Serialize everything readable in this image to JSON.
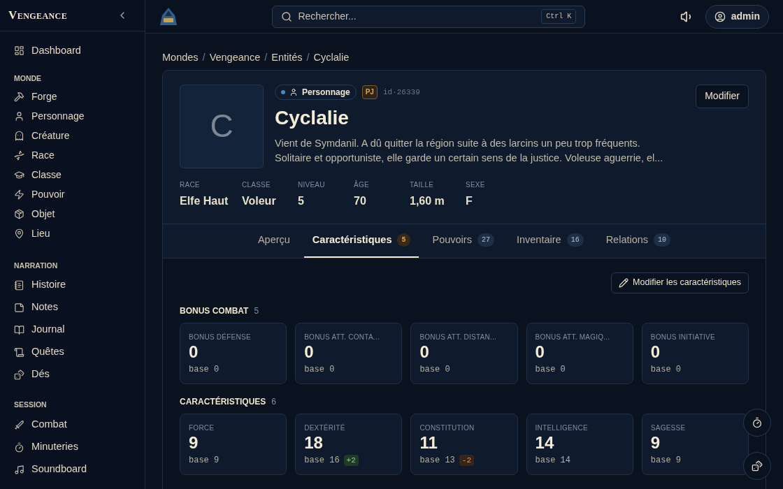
{
  "sidebar": {
    "brand": "Vengeance",
    "sections": [
      {
        "items": [
          "Dashboard"
        ]
      },
      {
        "heading": "MONDE",
        "items": [
          "Forge",
          "Personnage",
          "Créature",
          "Race",
          "Classe",
          "Pouvoir",
          "Objet",
          "Lieu"
        ]
      },
      {
        "heading": "NARRATION",
        "items": [
          "Histoire",
          "Notes",
          "Journal",
          "Quêtes",
          "Dés"
        ]
      },
      {
        "heading": "SESSION",
        "items": [
          "Combat",
          "Minuteries",
          "Soundboard"
        ]
      }
    ]
  },
  "topbar": {
    "search": {
      "placeholder": "Rechercher...",
      "shortcut": "Ctrl K"
    },
    "user": "admin"
  },
  "breadcrumb": {
    "separator": "/",
    "items": [
      "Mondes",
      "Vengeance",
      "Entités",
      "Cyclalie"
    ]
  },
  "entity": {
    "initial": "C",
    "type": "Personnage",
    "tag": "PJ",
    "id": "id·26339",
    "name": "Cyclalie",
    "edit": "Modifier",
    "description": "Vient de Symdanil. A dû quitter la région suite à des larcins un peu trop fréquents. Solitaire et opportuniste, elle garde un certain sens de la justice. Voleuse aguerrie, el...",
    "facts": [
      {
        "label": "RACE",
        "value": "Elfe Haut"
      },
      {
        "label": "CLASSE",
        "value": "Voleur"
      },
      {
        "label": "NIVEAU",
        "value": "5"
      },
      {
        "label": "ÂGE",
        "value": "70"
      },
      {
        "label": "TAILLE",
        "value": "1,60 m"
      },
      {
        "label": "SEXE",
        "value": "F"
      }
    ]
  },
  "tabs": [
    {
      "label": "Aperçu",
      "selected": false
    },
    {
      "label": "Caractéristiques",
      "count": "5",
      "selected": true
    },
    {
      "label": "Pouvoirs",
      "count": "27",
      "selected": false
    },
    {
      "label": "Inventaire",
      "count": "16",
      "selected": false
    },
    {
      "label": "Relations",
      "count": "10",
      "selected": false
    }
  ],
  "edit_stats": "Modifier les caractéristiques",
  "groups": [
    {
      "title": "BONUS COMBAT",
      "count": "5",
      "stats": [
        {
          "label": "BONUS DÉFENSE",
          "value": "0",
          "base": "base 0"
        },
        {
          "label": "BONUS ATT. CONTA...",
          "value": "0",
          "base": "base 0"
        },
        {
          "label": "BONUS ATT. DISTAN...",
          "value": "0",
          "base": "base 0"
        },
        {
          "label": "BONUS ATT. MAGIQ...",
          "value": "0",
          "base": "base 0"
        },
        {
          "label": "BONUS INITIATIVE",
          "value": "0",
          "base": "base 0"
        }
      ]
    },
    {
      "title": "CARACTÉRISTIQUES",
      "count": "6",
      "stats": [
        {
          "label": "FORCE",
          "value": "9",
          "base": "base 9"
        },
        {
          "label": "DEXTÉRITÉ",
          "value": "18",
          "base": "base 16",
          "delta": {
            "text": "+2",
            "kind": "up"
          }
        },
        {
          "label": "CONSTITUTION",
          "value": "11",
          "base": "base 13",
          "delta": {
            "text": "-2",
            "kind": "down"
          }
        },
        {
          "label": "INTELLIGENCE",
          "value": "14",
          "base": "base 14"
        },
        {
          "label": "SAGESSE",
          "value": "9",
          "base": "base 9"
        }
      ]
    }
  ]
}
